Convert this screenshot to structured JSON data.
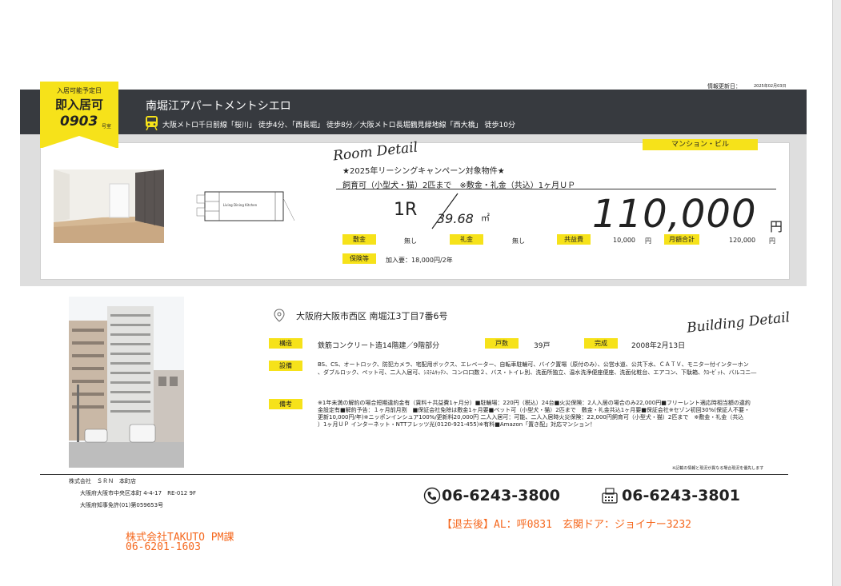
{
  "info": {
    "updated_label": "情報更新日：",
    "updated_date": "2025年02月03日"
  },
  "tag": {
    "top": "入居可能予定日",
    "main": "即入居可",
    "room_no": "0903",
    "room_suffix": "号室"
  },
  "header": {
    "building_name": "南堀江アパートメントシエロ",
    "access": "大阪メトロ千日前線「桜川」 徒歩4分、「西長堀」 徒歩8分／大阪メトロ長堀鶴見緑地線「西大橋」 徒歩10分"
  },
  "room": {
    "section_title": "Room Detail",
    "type": "マンション・ビル",
    "campaign": "★2025年リーシングキャンペーン対象物件★",
    "pets_note": "飼育可（小型犬・猫）2匹まで　※敷金・礼金（共込）1ヶ月ＵＰ",
    "layout": "1R",
    "area": "39.68",
    "area_unit": "㎡",
    "rent": "110,000",
    "rent_unit": "円",
    "fees": {
      "deposit_label": "敷金",
      "deposit": "無し",
      "key_label": "礼金",
      "key": "無し",
      "common_label": "共益費",
      "common": "10,000",
      "common_unit": "円",
      "monthly_label": "月額合計",
      "monthly": "120,000",
      "monthly_unit": "円"
    },
    "insurance_label": "保険等",
    "insurance": "加入要：18,000円/2年",
    "floorplan_text": "Living Dining Kitchen"
  },
  "building": {
    "section_title": "Building Detail",
    "address": "大阪府大阪市西区 南堀江3丁目7番6号",
    "structure_label": "構造",
    "structure": "鉄筋コンクリート造14階建／9階部分",
    "units_label": "戸数",
    "units": "39戸",
    "completed_label": "完成",
    "completed": "2008年2月13日",
    "facilities_label": "設備",
    "facilities_1": "BS、CS、オートロック、防犯カメラ、宅配用ボックス、エレベーター、自転車駐輪可、バイク置場（原付のみ）、公営水道、公共下水、ＣＡＴＶ、モニター付インターホン",
    "facilities_2": "、ダブルロック、ペット可、二人入居可、ｼｽﾃﾑｷｯﾁﾝ、コンロ口数２、バス・トイレ別、洗面所独立、温水洗浄便座便座、洗面化粧台、エアコン、下駄箱、ｸﾛｰｾﾞｯﾄ、バルコニ―",
    "notes_label": "備考",
    "notes_1": "※1年未満の解約の場合短期違約金有（賃料＋共益費1ヶ月分）■駐輪場：220円（税込）24台■火災保険：2人入居の場合のみ22,000円■フリーレント適応時相当額の違約",
    "notes_2": "金設定有■解約予告：１ヶ月前月割　■保証会社免除は敷金1ヶ月要■ペット可（小型犬・猫）2匹まで　敷金・礼金共込1ヶ月要■保証会社※セゾン初回30%(保証人不要・",
    "notes_3": "更新10,000円/年)※ニッポンインシュア100%/更新料20,000円 二人入居可：可能、二人入居時火災保険：22,000円飼育可（小型犬・猫）2匹まで　※敷金・礼金（共込",
    "notes_4": "）1ヶ月ＵＰ インターネット・NTTフレッツ光(0120-921-455)※有料■Amazon「置き配」対応マンション！",
    "disclaimer": "※記載の情報と現況が異なる場合現況を優先します"
  },
  "footer": {
    "company": "株式会社　ＳＲＮ　本町店",
    "address": "大阪府大阪市中央区本町 4-4-17　RE-012 9F",
    "license": "大阪府知事免許(01)第059653号",
    "tel": "06-6243-3800",
    "fax": "06-6243-3801",
    "pm_company": "株式会社TAKUTO PM課",
    "pm_tel": "06-6201-1603",
    "after_move_out": "【退去後】AL：呼0831　玄関ドア：ジョイナー3232"
  },
  "colors": {
    "accent": "#f6e21a",
    "header": "#373a3f",
    "orange": "#f5681e"
  }
}
